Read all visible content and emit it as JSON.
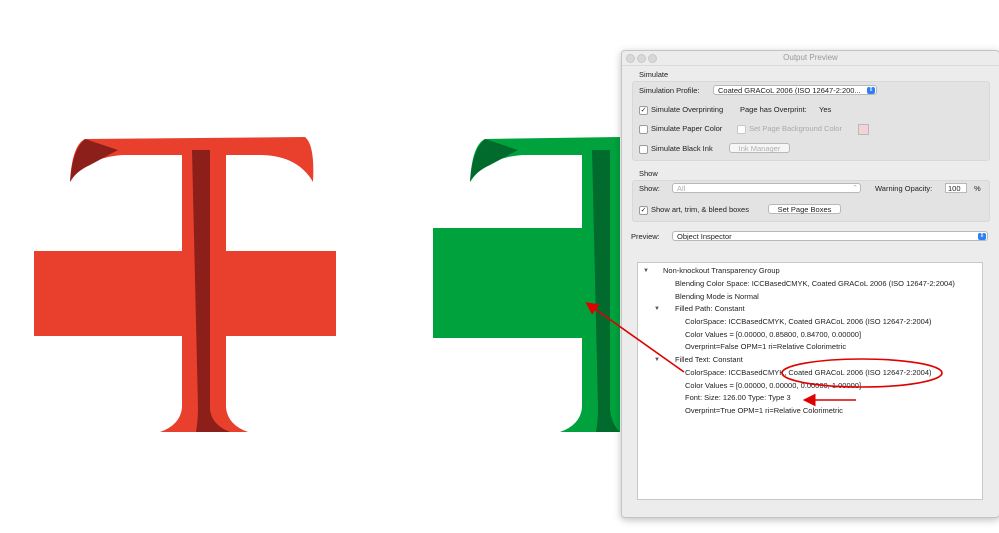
{
  "window": {
    "title": "Output Preview"
  },
  "simulate": {
    "header": "Simulate",
    "profile_label": "Simulation Profile:",
    "profile_value": "Coated GRACoL 2006 (ISO 12647-2:200...",
    "overprinting_label": "Simulate Overprinting",
    "overprinting_checked": true,
    "page_overprint_label": "Page has Overprint:",
    "page_overprint_value": "Yes",
    "paper_color_label": "Simulate Paper Color",
    "page_bg_label": "Set Page Background Color",
    "black_ink_label": "Simulate Black Ink",
    "ink_manager_label": "Ink Manager"
  },
  "show": {
    "header": "Show",
    "show_label": "Show:",
    "show_value": "All",
    "warning_label": "Warning Opacity:",
    "warning_value": "100",
    "warning_unit": "%",
    "art_boxes_label": "Show art, trim, & bleed boxes",
    "set_page_boxes_label": "Set Page Boxes"
  },
  "preview": {
    "label": "Preview:",
    "value": "Object Inspector"
  },
  "inspector": {
    "rows": [
      "Non-knockout Transparency Group",
      "Blending Color Space: ICCBasedCMYK, Coated GRACoL 2006 (ISO 12647-2:2004)",
      "Blending Mode is Normal",
      "Filled Path: Constant",
      "ColorSpace: ICCBasedCMYK, Coated GRACoL 2006 (ISO 12647-2:2004)",
      "Color Values = [0.00000, 0.85800, 0.84700, 0.00000]",
      "Overprint=False OPM=1 ri=Relative Colorimetric",
      "Filled Text: Constant",
      "ColorSpace: ICCBasedCMYK, Coated GRACoL 2006 (ISO 12647-2:2004)",
      "Color Values = [0.00000, 0.00000, 0.00000, 1.00000]",
      "Font:  Size: 126.00 Type: Type 3",
      "Overprint=True OPM=1 ri=Relative Colorimetric"
    ]
  },
  "colors": {
    "red": "#e8402c",
    "dark_red": "#8d1f1a",
    "green": "#00a23e",
    "dark_green": "#006b2c",
    "annotation": "#e00000",
    "accent": "#2f7ef6"
  }
}
